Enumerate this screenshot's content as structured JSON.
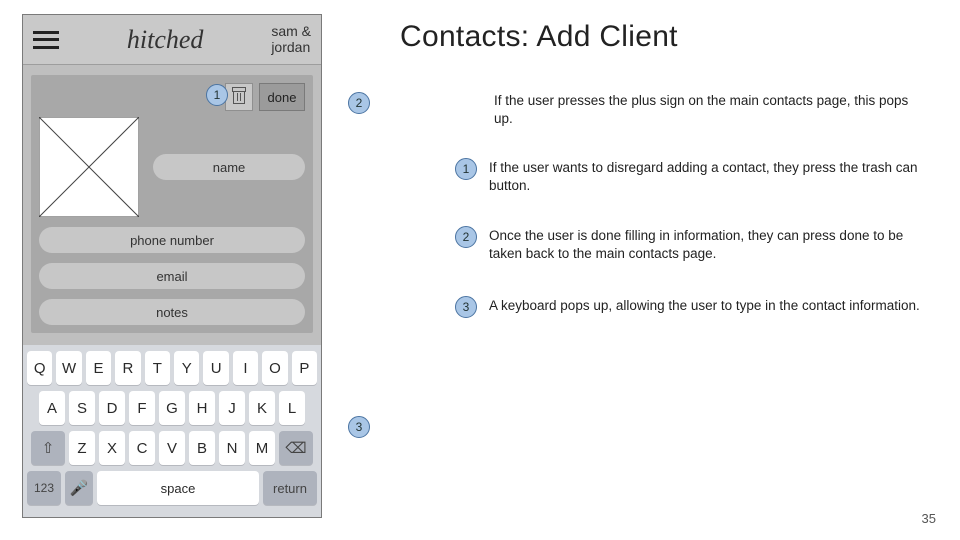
{
  "header": {
    "app_name": "hitched",
    "user_line1": "sam &",
    "user_line2": "jordan"
  },
  "actions": {
    "done_label": "done"
  },
  "fields": {
    "name": "name",
    "phone": "phone number",
    "email": "email",
    "notes": "notes"
  },
  "keyboard": {
    "row1": [
      "Q",
      "W",
      "E",
      "R",
      "T",
      "Y",
      "U",
      "I",
      "O",
      "P"
    ],
    "row2": [
      "A",
      "S",
      "D",
      "F",
      "G",
      "H",
      "J",
      "K",
      "L"
    ],
    "row3": [
      "Z",
      "X",
      "C",
      "V",
      "B",
      "N",
      "M"
    ],
    "shift": "⇧",
    "backspace": "⌫",
    "mode": "123",
    "mic": "🎤",
    "space": "space",
    "return": "return"
  },
  "title": "Contacts: Add Client",
  "subtitle": "If the user presses the plus sign on the main contacts page, this pops up.",
  "annotations": [
    {
      "n": "1",
      "text": "If the user wants to disregard adding a contact, they press the trash can button."
    },
    {
      "n": "2",
      "text": "Once the user is done filling in information, they can press done to be taken back to the main contacts page."
    },
    {
      "n": "3",
      "text": "A keyboard pops up, allowing the user to type in the contact information."
    }
  ],
  "bubbles": {
    "one": "1",
    "two": "2",
    "three": "3"
  },
  "page_number": "35"
}
